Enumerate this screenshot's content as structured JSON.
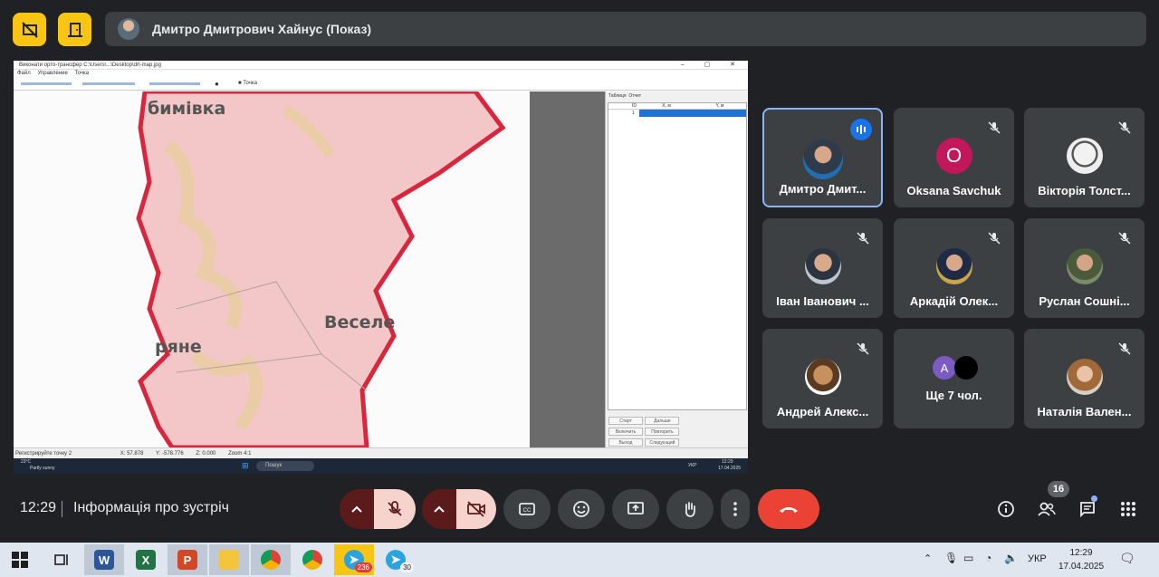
{
  "top": {
    "presenter_name": "Дмитро Дмитрович Хайнус (Показ)"
  },
  "shared_screen": {
    "window_title": "Виконати орто-трансфер C:\\Users\\...\\Desktop\\drt-map.jpg",
    "menu": [
      "Файл",
      "Управление",
      "Точка"
    ],
    "toolbar_checkbox": "Точка",
    "map_labels": [
      "бимівка",
      "Веселе",
      "ряне"
    ],
    "panel_tabs": [
      "Таблиця",
      "Отчет"
    ],
    "grid_headers": [
      "ID",
      "X, м",
      "Y, м"
    ],
    "grid_row_id": "1",
    "panel_buttons": [
      "Старт",
      "Дальше",
      "Включить",
      "Повторить",
      "Выход",
      "Следующий"
    ],
    "status": {
      "left": "Регистрируйте точку 2",
      "x": "X: 57.878",
      "y": "Y: -578.776",
      "z": "Z: 0.000",
      "zoom": "Zoom 4:1"
    },
    "weather_temp": "23°C",
    "weather_text": "Partly sunny",
    "search": "Пошук",
    "lang": "УКР",
    "time": "12:29",
    "date": "17.04.2025"
  },
  "participants": [
    {
      "name": "Дмитро Дмит...",
      "speaking": true
    },
    {
      "name": "Oksana Savchuk",
      "letter": "O"
    },
    {
      "name": "Вікторія Толст..."
    },
    {
      "name": "Іван Іванович ..."
    },
    {
      "name": "Аркадій Олек..."
    },
    {
      "name": "Руслан Сошні..."
    },
    {
      "name": "Андрей Алекс..."
    },
    {
      "name": "Ще 7 чол.",
      "letter": "A"
    },
    {
      "name": "Наталія Вален..."
    }
  ],
  "meet": {
    "time": "12:29",
    "title": "Інформація про зустріч",
    "participants_count": "16"
  },
  "taskbar": {
    "badges": [
      "236",
      "30"
    ],
    "lang": "УКР",
    "time": "12:29",
    "date": "17.04.2025"
  },
  "colors": {
    "accent_yellow": "#f9c513",
    "end_call": "#ea4335",
    "active_border": "#8ab4f8",
    "map_fill": "#f3c7c7",
    "map_border": "#d7263d"
  }
}
